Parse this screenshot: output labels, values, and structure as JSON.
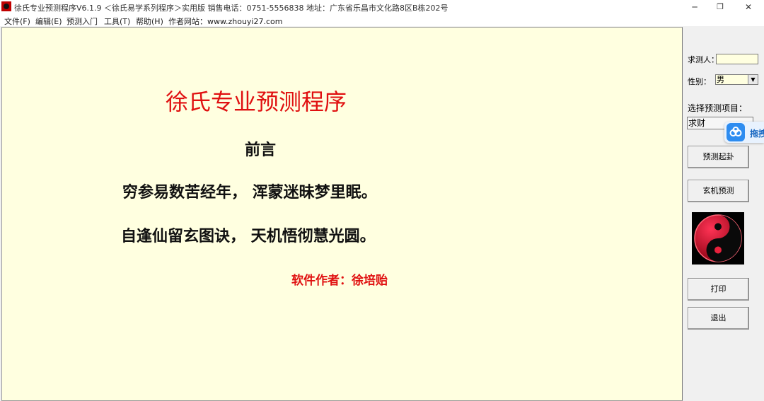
{
  "window": {
    "title": "徐氏专业预测程序V6.1.9  ＜徐氏易学系列程序＞实用版   销售电话：0751-5556838   地址：广东省乐昌市文化路8区B栋202号",
    "controls": {
      "minimize": "─",
      "maximize": "❐",
      "close": "✕"
    }
  },
  "menu": [
    "文件(F)",
    "编辑(E)",
    "预测入门",
    "工具(T)",
    "帮助(H)",
    "作者网站：www.zhouyi27.com"
  ],
  "main": {
    "heading": "徐氏专业预测程序",
    "subheading": "前言",
    "poem_line1": "穷参易数苦经年，  浑蒙迷昧梦里眠。",
    "poem_line2": "自逢仙留玄图诀，  天机悟彻慧光圆。",
    "author": "软件作者：徐培贻"
  },
  "sidebar": {
    "person_label": "求测人：",
    "person_value": "",
    "gender_label": "性别：",
    "gender_value": "男",
    "project_label": "选择预测项目：",
    "project_value": "求财",
    "btn_start": "预测起卦",
    "btn_mystic": "玄机预测",
    "btn_print": "打印",
    "btn_exit": "退出"
  },
  "popup": {
    "label": "拖拽"
  },
  "colors": {
    "content_bg": "#ffffe0",
    "heading": "#e01010",
    "author": "#e01010",
    "text": "#111111"
  }
}
